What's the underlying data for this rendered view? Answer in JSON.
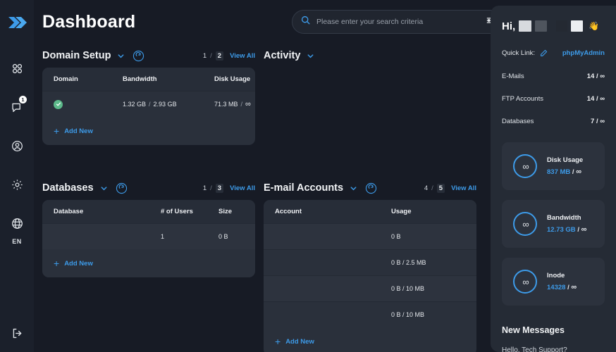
{
  "app": {
    "title": "Dashboard",
    "logo_icon": "double-chevron-logo",
    "accent": "#3d9be9",
    "bg": "#171b25",
    "card_bg": "#2a303b"
  },
  "search": {
    "placeholder": "Please enter your search criteria",
    "value": "",
    "search_icon": "search-icon",
    "filter_icon": "sliders-filter-icon"
  },
  "sidebar": {
    "items": [
      {
        "name": "apps-grid",
        "icon": "grid-apps-icon",
        "badge": ""
      },
      {
        "name": "messages",
        "icon": "chat-bubble-icon",
        "badge": "1"
      },
      {
        "name": "account",
        "icon": "user-circle-icon",
        "badge": ""
      },
      {
        "name": "settings",
        "icon": "gear-icon",
        "badge": ""
      },
      {
        "name": "language",
        "icon": "globe-icon",
        "badge": ""
      }
    ],
    "language_label": "EN",
    "logout_icon": "logout-icon"
  },
  "sections": {
    "domain_setup": {
      "title": "Domain Setup",
      "chevron_icon": "chevron-down-icon",
      "refresh_icon": "refresh-icon",
      "page_current": "1",
      "page_total": "2",
      "view_all": "View All",
      "columns": [
        "Domain",
        "Bandwidth",
        "Disk Usage"
      ],
      "rows": [
        {
          "status_icon": "check-circle-green",
          "domain": "",
          "bandwidth_used": "1.32 GB",
          "bandwidth_sep": "/",
          "bandwidth_limit": "2.93 GB",
          "disk_used": "71.3 MB",
          "disk_sep": "/",
          "disk_limit": "∞"
        }
      ],
      "add_new": "Add New"
    },
    "activity": {
      "title": "Activity",
      "chevron_icon": "chevron-down-icon"
    },
    "databases": {
      "title": "Databases",
      "chevron_icon": "chevron-down-icon",
      "refresh_icon": "refresh-icon",
      "page_current": "1",
      "page_total": "3",
      "view_all": "View All",
      "columns": [
        "Database",
        "# of Users",
        "Size"
      ],
      "rows": [
        {
          "database": "",
          "users": "1",
          "size": "0 B"
        }
      ],
      "add_new": "Add New"
    },
    "email_accounts": {
      "title": "E-mail Accounts",
      "chevron_icon": "chevron-down-icon",
      "refresh_icon": "refresh-icon",
      "page_current": "4",
      "page_total": "5",
      "view_all": "View All",
      "columns": [
        "Account",
        "Usage"
      ],
      "rows": [
        {
          "account": "",
          "usage": "0 B"
        },
        {
          "account": "",
          "usage": "0 B / 2.5 MB"
        },
        {
          "account": "",
          "usage": "0 B / 10 MB"
        },
        {
          "account": "",
          "usage": "0 B / 10 MB"
        }
      ],
      "add_new": "Add New"
    }
  },
  "right_panel": {
    "greeting": "Hi,",
    "name_redacted": true,
    "wave_icon": "waving-hand-icon",
    "quick_link_label": "Quick Link:",
    "edit_icon": "pencil-icon",
    "quick_link_value": "phpMyAdmin",
    "stats": [
      {
        "label": "E-Mails",
        "value": "14 / ∞"
      },
      {
        "label": "FTP Accounts",
        "value": "14 / ∞"
      },
      {
        "label": "Databases",
        "value": "7 / ∞"
      }
    ],
    "usage_cards": [
      {
        "icon": "infinity-icon",
        "label": "Disk Usage",
        "value": "837 MB",
        "sep": "/",
        "limit": "∞"
      },
      {
        "icon": "infinity-icon",
        "label": "Bandwidth",
        "value": "12.73 GB",
        "sep": "/",
        "limit": "∞"
      },
      {
        "icon": "infinity-icon",
        "label": "Inode",
        "value": "14328",
        "sep": "/",
        "limit": "∞"
      }
    ],
    "messages_title": "New Messages",
    "messages_preview": "Hello, Tech Support?"
  }
}
